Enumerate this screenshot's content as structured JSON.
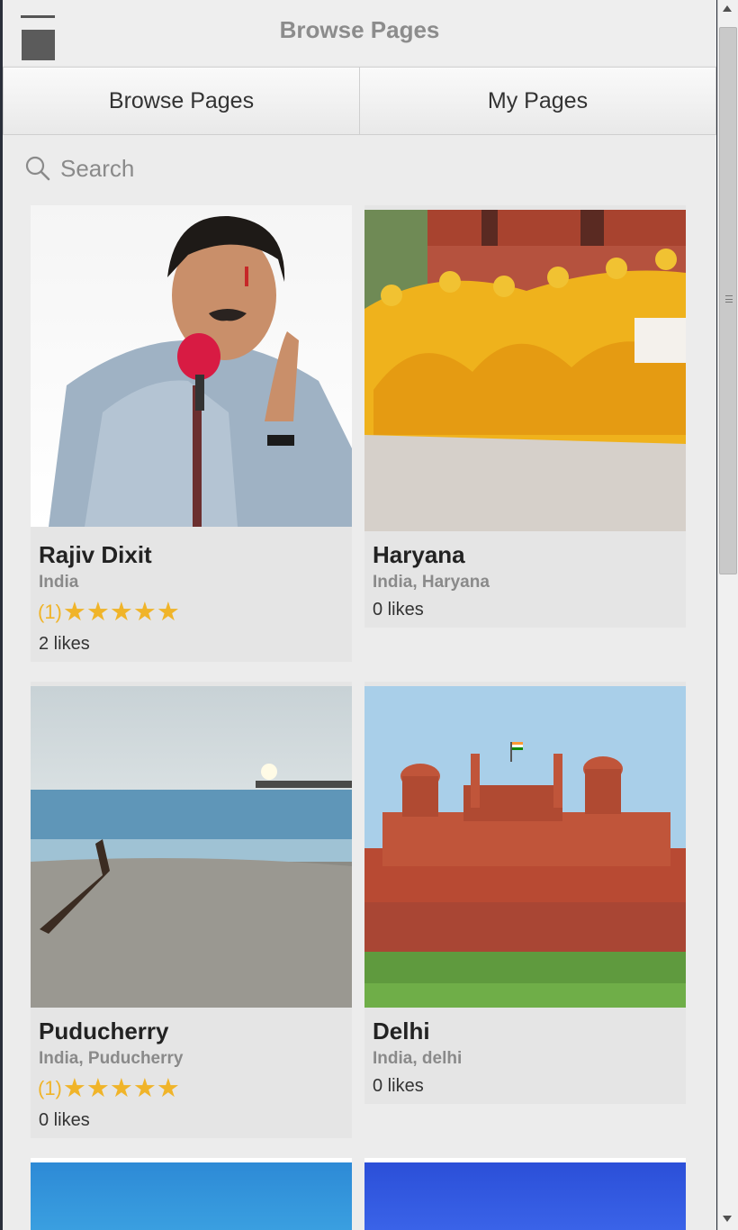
{
  "header": {
    "title": "Browse Pages"
  },
  "tabs": [
    {
      "label": "Browse Pages"
    },
    {
      "label": "My Pages"
    }
  ],
  "search": {
    "placeholder": "Search"
  },
  "pages": [
    {
      "name": "Rajiv Dixit",
      "location": "India",
      "rating_count": "(1)",
      "stars": 5,
      "likes": "2 likes"
    },
    {
      "name": "Haryana",
      "location": "India, Haryana",
      "likes": "0 likes"
    },
    {
      "name": "Puducherry",
      "location": "India, Puducherry",
      "rating_count": "(1)",
      "stars": 5,
      "likes": "0 likes"
    },
    {
      "name": "Delhi",
      "location": "India, delhi",
      "likes": "0 likes"
    }
  ],
  "colors": {
    "star": "#f0b429",
    "title": "#8c8c8c",
    "card_bg": "#e5e5e5"
  }
}
